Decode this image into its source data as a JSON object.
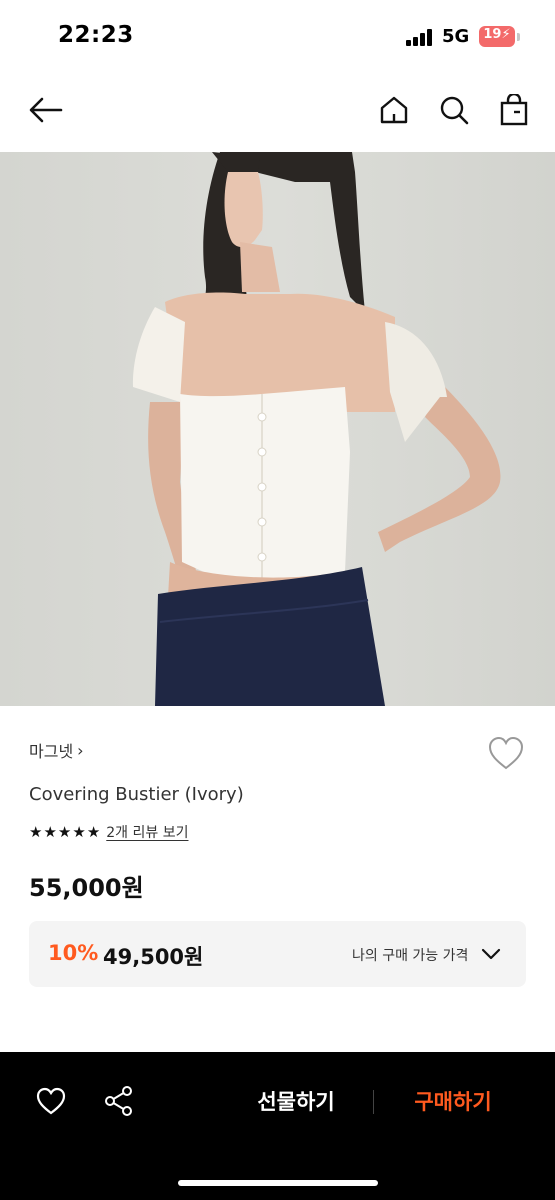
{
  "status_bar": {
    "time": "22:23",
    "network": "5G",
    "battery": "19"
  },
  "nav": {
    "back_icon": "arrow-left-icon",
    "home_icon": "home-icon",
    "search_icon": "search-icon",
    "cart_icon": "shopping-bag-icon"
  },
  "product": {
    "image_icon": "product-photo",
    "brand": "마그넷",
    "brand_chevron": "›",
    "name": "Covering Bustier (Ivory)",
    "rating_stars": 5,
    "review_link": "2개 리뷰 보기",
    "original_price": "55,000원",
    "discount_rate": "10%",
    "discount_price": "49,500원",
    "my_price_label": "나의 구매 가능 가격"
  },
  "bottom_bar": {
    "wishlist_icon": "heart-icon",
    "share_icon": "share-icon",
    "gift_label": "선물하기",
    "buy_label": "구매하기"
  },
  "colors": {
    "accent": "#ff5a1f",
    "bottom_bar_bg": "#000000",
    "price_box_bg": "#f4f4f4"
  }
}
